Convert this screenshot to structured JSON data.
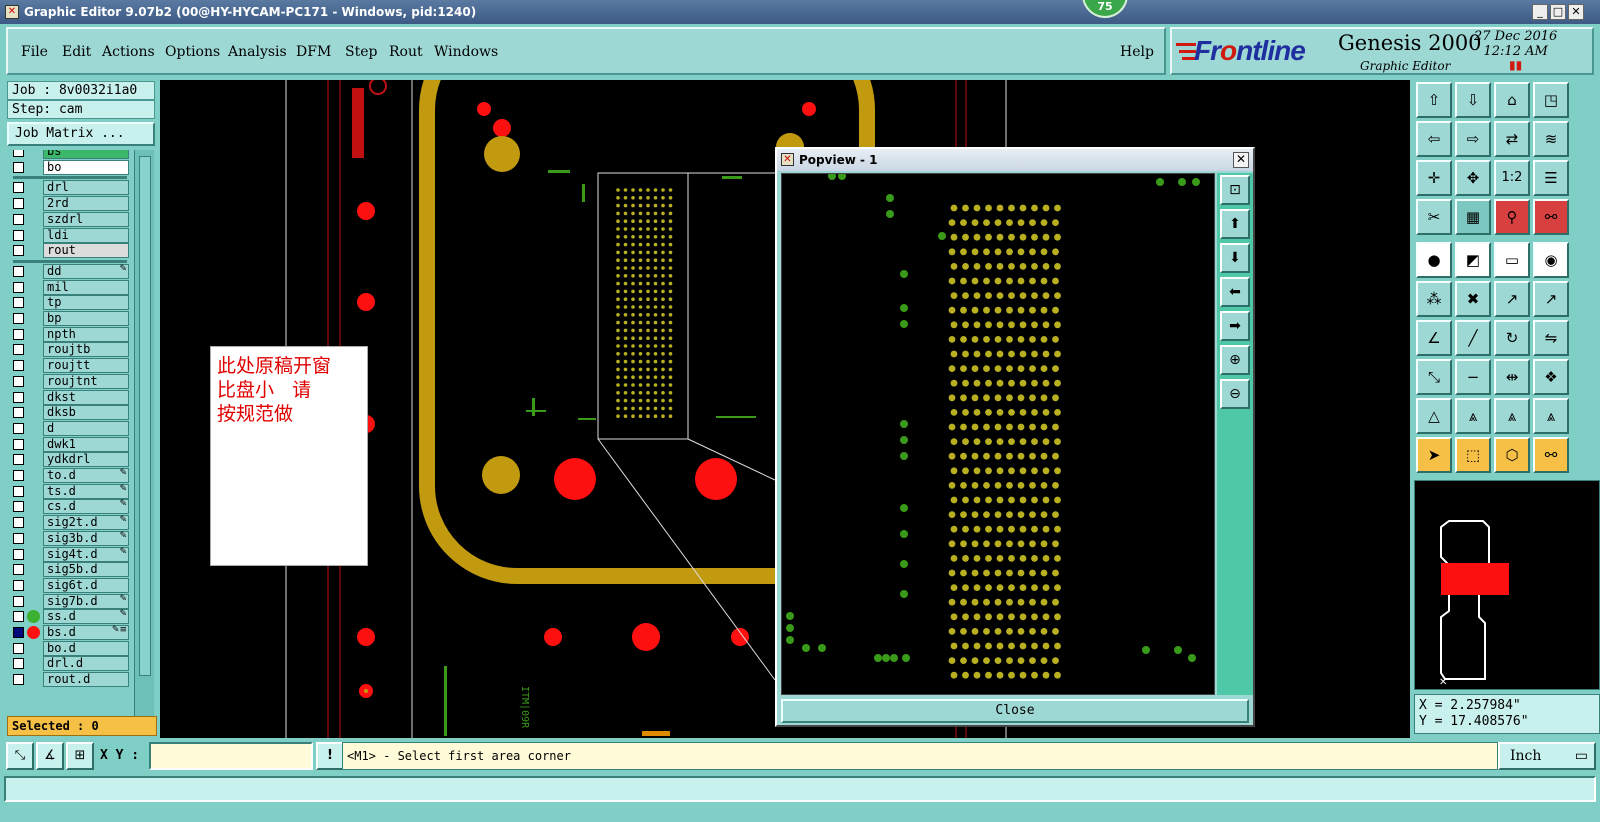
{
  "window": {
    "title": "Graphic Editor 9.07b2 (00@HY-HYCAM-PC171 - Windows, pid:1240)",
    "badge": "75",
    "controls": [
      "_",
      "□",
      "✕"
    ]
  },
  "menu": {
    "items": [
      "File",
      "Edit",
      "Actions",
      "Options",
      "Analysis",
      "DFM",
      "Step",
      "Rout",
      "Windows"
    ],
    "help": "Help"
  },
  "brand": {
    "logo_prefix": "Fr",
    "logo_suffix": "ntline",
    "logo_o": "o",
    "product": "Genesis 2000",
    "subtitle": "Graphic Editor",
    "date": "27 Dec 2016",
    "time": "12:12  AM"
  },
  "job": {
    "job": "Job : 8v0032i1a0",
    "step": "Step: cam",
    "matrix_button": "Job Matrix ..."
  },
  "layers": [
    {
      "name": "bs",
      "mark": "✎",
      "color": "#3cb86a"
    },
    {
      "name": "bo",
      "mark": "",
      "color": "#ffffff"
    },
    {
      "name": "drl",
      "mark": "",
      "color": "#9ed8d4"
    },
    {
      "name": "2rd",
      "mark": "",
      "color": "#9ed8d4"
    },
    {
      "name": "szdrl",
      "mark": "",
      "color": "#9ed8d4"
    },
    {
      "name": "ldi",
      "mark": "",
      "color": "#9ed8d4"
    },
    {
      "name": "rout",
      "mark": "",
      "color": "#dcdcdc"
    },
    {
      "name": "dd",
      "mark": "✎",
      "color": "#9ed8d4"
    },
    {
      "name": "mil",
      "mark": "",
      "color": "#9ed8d4"
    },
    {
      "name": "tp",
      "mark": "",
      "color": "#9ed8d4"
    },
    {
      "name": "bp",
      "mark": "",
      "color": "#9ed8d4"
    },
    {
      "name": "npth",
      "mark": "",
      "color": "#9ed8d4"
    },
    {
      "name": "roujtb",
      "mark": "",
      "color": "#9ed8d4"
    },
    {
      "name": "roujtt",
      "mark": "",
      "color": "#9ed8d4"
    },
    {
      "name": "roujtnt",
      "mark": "",
      "color": "#9ed8d4"
    },
    {
      "name": "dkst",
      "mark": "",
      "color": "#9ed8d4"
    },
    {
      "name": "dksb",
      "mark": "",
      "color": "#9ed8d4"
    },
    {
      "name": "d",
      "mark": "",
      "color": "#9ed8d4"
    },
    {
      "name": "dwk1",
      "mark": "",
      "color": "#9ed8d4"
    },
    {
      "name": "ydkdrl",
      "mark": "",
      "color": "#9ed8d4"
    },
    {
      "name": "to.d",
      "mark": "✎",
      "color": "#9ed8d4"
    },
    {
      "name": "ts.d",
      "mark": "✎",
      "color": "#9ed8d4"
    },
    {
      "name": "cs.d",
      "mark": "✎",
      "color": "#9ed8d4"
    },
    {
      "name": "sig2t.d",
      "mark": "✎",
      "color": "#9ed8d4"
    },
    {
      "name": "sig3b.d",
      "mark": "✎",
      "color": "#9ed8d4"
    },
    {
      "name": "sig4t.d",
      "mark": "✎",
      "color": "#9ed8d4"
    },
    {
      "name": "sig5b.d",
      "mark": "",
      "color": "#9ed8d4"
    },
    {
      "name": "sig6t.d",
      "mark": "",
      "color": "#9ed8d4"
    },
    {
      "name": "sig7b.d",
      "mark": "✎",
      "color": "#9ed8d4"
    },
    {
      "name": "ss.d",
      "mark": "✎",
      "color": "#9ed8d4",
      "dot": "#3cb030"
    },
    {
      "name": "bs.d",
      "mark": "✎≡",
      "color": "#9ed8d4",
      "dot": "#ff1010",
      "selected": true
    },
    {
      "name": "bo.d",
      "mark": "",
      "color": "#9ed8d4"
    },
    {
      "name": "drl.d",
      "mark": "",
      "color": "#9ed8d4"
    },
    {
      "name": "rout.d",
      "mark": "",
      "color": "#9ed8d4"
    }
  ],
  "selected_label": "Selected : 0",
  "canvas": {
    "note_lines": [
      "此处原稿开窗",
      "比盘小   请",
      "按规范做"
    ],
    "side_text": "ITM|09R"
  },
  "popview": {
    "title": "Popview - 1",
    "close_label": "Close"
  },
  "coords": {
    "x": "X =  2.257984\"",
    "y": "Y = 17.408576\""
  },
  "bottom": {
    "xy_label": "X Y :",
    "xy_value": "",
    "message": "<M1> - Select first area corner",
    "unit": "Inch"
  },
  "colors": {
    "teal": "#7fcfc7",
    "gold": "#c29a10",
    "pad_red": "#ff1010",
    "pad_yellow": "#b8b020",
    "pad_green": "#3a9a1a"
  }
}
